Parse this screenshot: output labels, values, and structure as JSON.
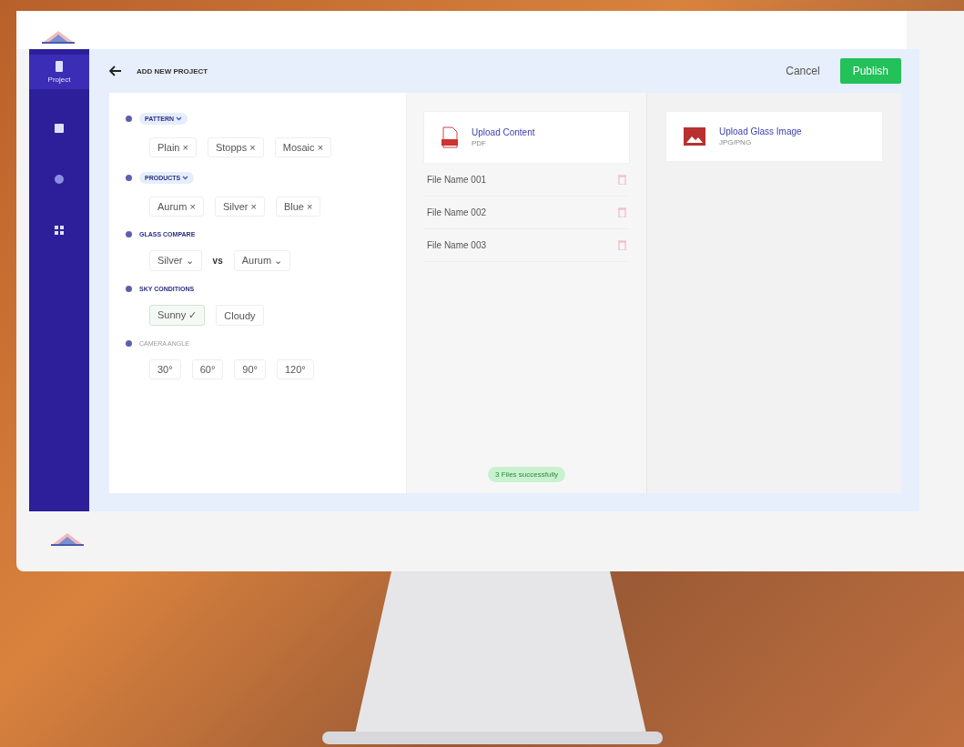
{
  "sidebar": {
    "items": [
      {
        "label": "Project",
        "selected": true
      },
      {
        "selected": false
      },
      {
        "selected": false
      },
      {
        "selected": false
      }
    ]
  },
  "header": {
    "title": "ADD NEW PROJECT",
    "cancel": "Cancel",
    "publish": "Publish"
  },
  "sections": [
    {
      "title": "PATTERN",
      "kind": "dropdown",
      "chips": [
        {
          "kind": "tag",
          "label": "Plain",
          "suffix": "×"
        },
        {
          "kind": "tag",
          "label": "Stopps",
          "suffix": "×"
        },
        {
          "kind": "tag",
          "label": "Mosaic",
          "suffix": "×"
        }
      ]
    },
    {
      "title": "PRODUCTS",
      "kind": "dropdown",
      "chips": [
        {
          "kind": "tag",
          "label": "Aurum",
          "suffix": "×"
        },
        {
          "kind": "tag",
          "label": "Silver",
          "suffix": "×"
        },
        {
          "kind": "tag",
          "label": "Blue",
          "suffix": "×"
        }
      ]
    },
    {
      "title": "GLASS COMPARE",
      "kind": "plain",
      "chips": [
        {
          "kind": "select",
          "label": "Silver",
          "suffix": "⌄"
        },
        {
          "kind": "separator",
          "label": "vs"
        },
        {
          "kind": "select",
          "label": "Aurum",
          "suffix": "⌄"
        }
      ]
    },
    {
      "title": "SKY CONDITIONS",
      "kind": "plain",
      "chips": [
        {
          "kind": "option",
          "label": "Sunny",
          "suffix": "✓",
          "selected": true
        },
        {
          "kind": "option",
          "label": "Cloudy",
          "selected": false
        }
      ]
    },
    {
      "title": "CAMERA ANGLE",
      "kind": "faint",
      "chips": [
        {
          "kind": "angle",
          "label": "30°"
        },
        {
          "kind": "angle",
          "label": "60°"
        },
        {
          "kind": "angle",
          "label": "90°"
        },
        {
          "kind": "angle",
          "label": "120°"
        }
      ]
    }
  ],
  "upload_content": {
    "title": "Upload Content",
    "subtitle": "PDF"
  },
  "files": [
    "File Name 001",
    "File Name 002",
    "File Name 003"
  ],
  "status": "3 Files successfully",
  "upload_image": {
    "title": "Upload Glass Image",
    "subtitle": "JPG/PNG"
  }
}
